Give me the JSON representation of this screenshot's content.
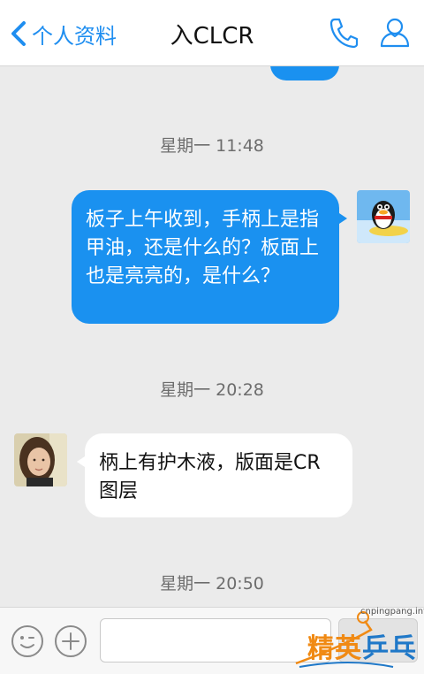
{
  "header": {
    "back_label": "个人资料",
    "title": "入CLCR"
  },
  "messages": [
    {
      "type": "time",
      "text": "星期一 11:48"
    },
    {
      "type": "outgoing",
      "text": "板子上午收到，手柄上是指甲油，还是什么的？板面上也是亮亮的，是什么？"
    },
    {
      "type": "time",
      "text": "星期一 20:28"
    },
    {
      "type": "incoming",
      "text": "柄上有护木液，版面是CR图层"
    },
    {
      "type": "time",
      "text": "星期一 20:50"
    }
  ],
  "input": {
    "value": "",
    "placeholder": ""
  },
  "watermark": {
    "url": "cnpingpang.info",
    "text_a": "精英",
    "text_b": "乒乓网"
  },
  "colors": {
    "accent": "#1a91f0",
    "background": "#ebebeb",
    "watermark_orange": "#f08a14",
    "watermark_blue": "#1f78c8"
  }
}
